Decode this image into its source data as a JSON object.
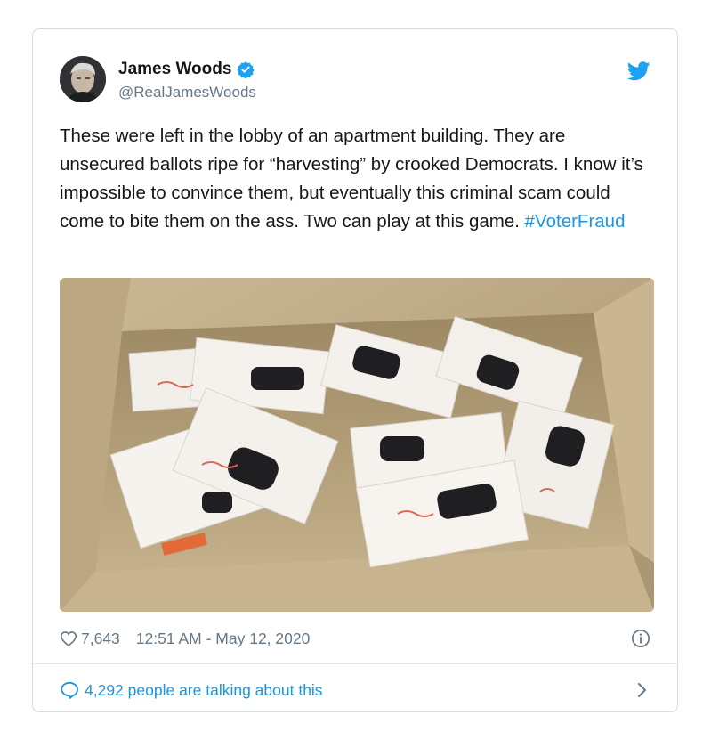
{
  "author": {
    "name": "James Woods",
    "handle": "@RealJamesWoods"
  },
  "tweet": {
    "text": "These were left in the lobby of an apartment building. They are unsecured ballots ripe for “harvesting” by crooked Democrats. I know it’s impossible to convince them, but eventually this criminal scam could come to bite them on the ass. Two can play at this game. ",
    "hashtag": "#VoterFraud"
  },
  "stats": {
    "likes": "7,643",
    "timestamp": "12:51 AM - May 12, 2020"
  },
  "talking": {
    "label": "4,292 people are talking about this"
  },
  "icons": {
    "verified": "verified-badge-icon",
    "logo": "twitter-bird-icon",
    "likes": "heart-icon",
    "info": "info-icon",
    "replies": "speech-bubble-icon",
    "more": "chevron-right-icon"
  },
  "colors": {
    "brand": "#1da1f2",
    "link": "#1b95e0",
    "muted": "#657786",
    "border": "#e1e8ed"
  }
}
